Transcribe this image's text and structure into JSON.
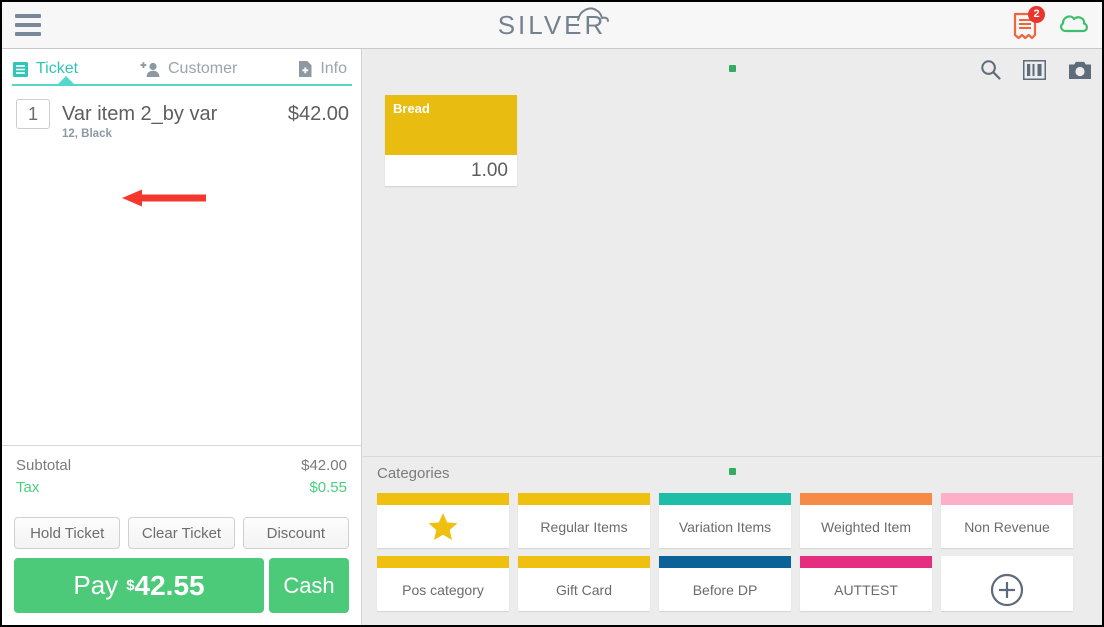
{
  "header": {
    "menu_icon": "hamburger-icon",
    "logo_text": "SILVER",
    "receipt_icon": "receipt-icon",
    "receipt_badge": "2",
    "cloud_icon": "cloud-icon",
    "receipt_color": "#f0663c",
    "cloud_color": "#3cc06b",
    "badge_color": "#e8342a"
  },
  "ticket": {
    "tabs": [
      {
        "label": "Ticket",
        "icon": "ticket-list-icon",
        "active": true
      },
      {
        "label": "Customer",
        "icon": "add-person-icon",
        "active": false
      },
      {
        "label": "Info",
        "icon": "add-document-icon",
        "active": false
      }
    ],
    "active_color": "#31c5b8",
    "items": [
      {
        "qty": "1",
        "name": "Var item 2_by var",
        "variant": "12, Black",
        "price": "$42.00"
      }
    ],
    "totals": [
      {
        "label": "Subtotal",
        "value": "$42.00",
        "highlight": false
      },
      {
        "label": "Tax",
        "value": "$0.55",
        "highlight": true
      }
    ],
    "actions": [
      {
        "label": "Hold Ticket"
      },
      {
        "label": "Clear Ticket"
      },
      {
        "label": "Discount"
      }
    ],
    "pay": {
      "label": "Pay",
      "dollar": "$",
      "amount": "42.55",
      "cash_label": "Cash",
      "color": "#4dc97a"
    }
  },
  "main": {
    "toolbar": [
      {
        "icon": "search-icon"
      },
      {
        "icon": "barcode-icon"
      },
      {
        "icon": "camera-icon"
      }
    ],
    "page_indicator_color": "#32ac63",
    "products": [
      {
        "name": "Bread",
        "price": "1.00",
        "color": "#e8bc11"
      }
    ]
  },
  "categories": {
    "title": "Categories",
    "tiles": [
      {
        "label": "",
        "icon": "star-icon",
        "color": "#efc010"
      },
      {
        "label": "Regular Items",
        "icon": "",
        "color": "#efc010"
      },
      {
        "label": "Variation Items",
        "icon": "",
        "color": "#1dbda8"
      },
      {
        "label": "Weighted Item",
        "icon": "",
        "color": "#f58b47"
      },
      {
        "label": "Non Revenue",
        "icon": "",
        "color": "#fcafc6"
      },
      {
        "label": "Pos category",
        "icon": "",
        "color": "#efc010"
      },
      {
        "label": "Gift Card",
        "icon": "",
        "color": "#efc010"
      },
      {
        "label": "Before DP",
        "icon": "",
        "color": "#0a6296"
      },
      {
        "label": "AUTTEST",
        "icon": "",
        "color": "#e52e80"
      },
      {
        "label": "",
        "icon": "add-circle-icon",
        "color": "#ffffff"
      }
    ]
  },
  "annotation": {
    "arrow_color": "#f5382e",
    "name": "red-pointer-arrow"
  }
}
